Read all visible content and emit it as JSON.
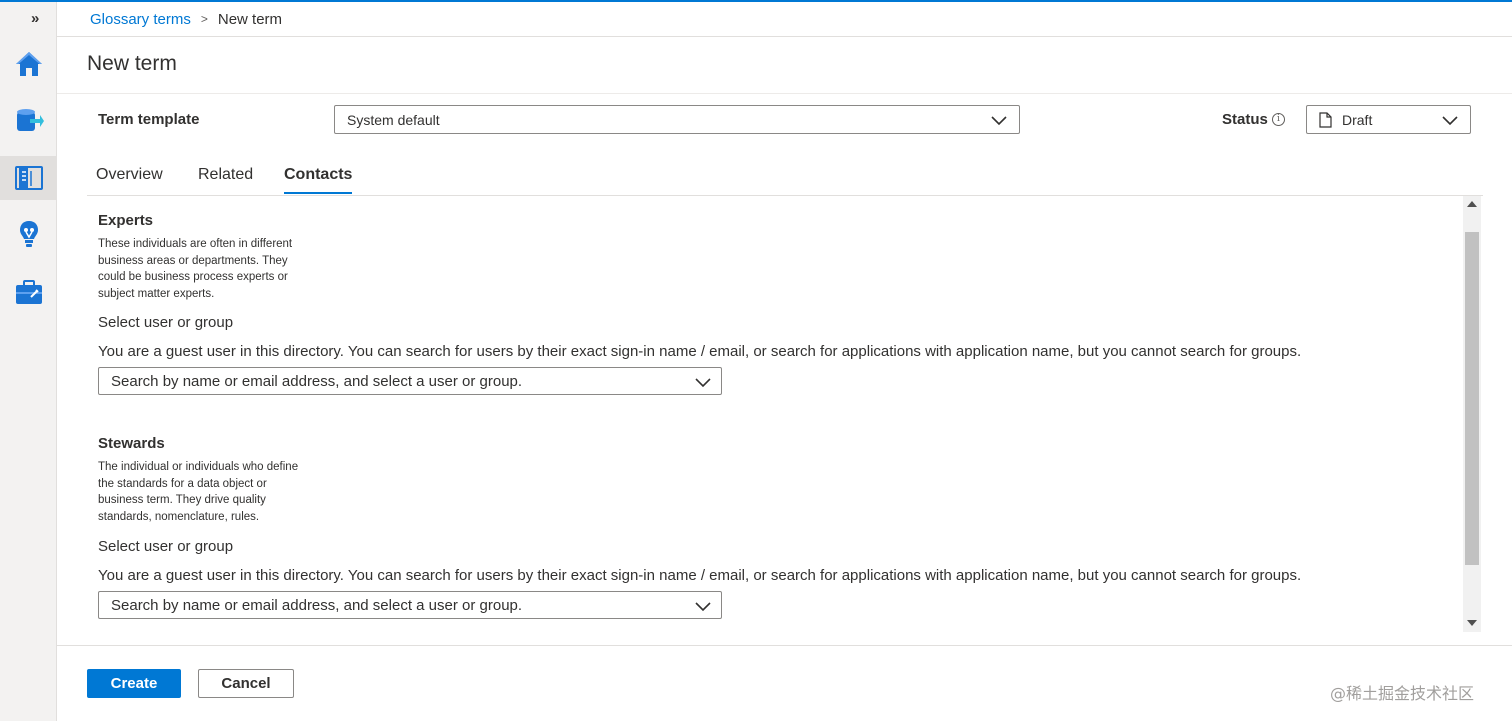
{
  "breadcrumb": {
    "parent": "Glossary terms",
    "separator": ">",
    "current": "New term"
  },
  "rail": {
    "expand_glyph": "»",
    "items": [
      {
        "icon": "home-icon",
        "active": false
      },
      {
        "icon": "data-map-icon",
        "active": false
      },
      {
        "icon": "glossary-book-icon",
        "active": true
      },
      {
        "icon": "insights-bulb-icon",
        "active": false
      },
      {
        "icon": "management-toolbox-icon",
        "active": false
      }
    ]
  },
  "page": {
    "title": "New term"
  },
  "template": {
    "label": "Term template",
    "value": "System default"
  },
  "status": {
    "label": "Status",
    "info_glyph": "i",
    "value": "Draft"
  },
  "tabs": [
    {
      "label": "Overview",
      "active": false
    },
    {
      "label": "Related",
      "active": false
    },
    {
      "label": "Contacts",
      "active": true
    }
  ],
  "experts": {
    "title": "Experts",
    "desc_lines": [
      "These individuals are often in different",
      "business areas or departments. They",
      "could be business process experts or",
      "subject matter experts."
    ],
    "select_label": "Select user or group",
    "guest_note": "You are a guest user in this directory. You can search for users by their exact sign-in name / email, or search for applications with application name, but you cannot search for groups.",
    "search_placeholder": "Search by name or email address, and select a user or group."
  },
  "stewards": {
    "title": "Stewards",
    "desc_lines": [
      "The individual or individuals who define",
      "the standards for a data object or",
      "business term. They drive quality",
      "standards, nomenclature, rules."
    ],
    "select_label": "Select user or group",
    "guest_note": "You are a guest user in this directory. You can search for users by their exact sign-in name / email, or search for applications with application name, but you cannot search for groups.",
    "search_placeholder": "Search by name or email address, and select a user or group."
  },
  "footer": {
    "create_label": "Create",
    "cancel_label": "Cancel"
  },
  "watermark": "@稀土掘金技术社区",
  "colors": {
    "accent": "#0078d4",
    "text": "#323130",
    "border": "#8a8886"
  }
}
